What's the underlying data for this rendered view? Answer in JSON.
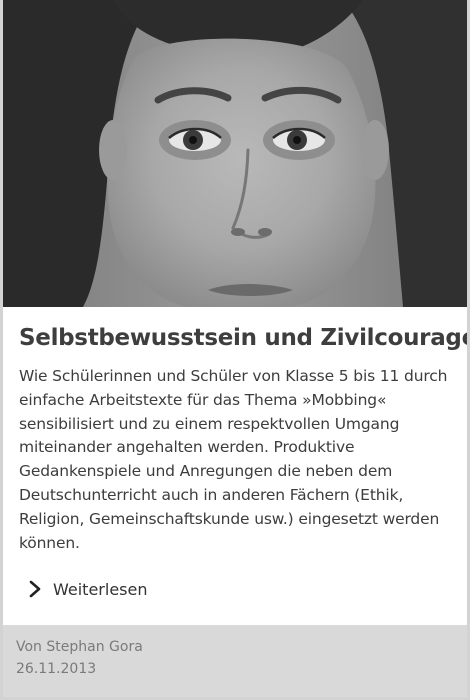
{
  "image": {
    "description_icon": "portrait-photo"
  },
  "article": {
    "title": "Selbstbewusstsein und Zivilcourage",
    "teaser": "Wie Schülerinnen und Schüler von Klasse 5 bis 11 durch einfache Arbeitstexte für das Thema »Mobbing« sensibilisiert und zu einem respektvollen Umgang miteinander angehalten werden. Produktive Gedankenspiele und Anregungen die neben dem Deutschunterricht auch in anderen Fächern (Ethik, Religion, Gemeinschaftskunde usw.) eingesetzt werden können.",
    "read_more_label": "Weiterlesen",
    "read_more_icon": "chevron-right-icon"
  },
  "footer": {
    "author": "Von Stephan Gora",
    "date": "26.11.2013"
  },
  "colors": {
    "footer_bg": "#d9d9d9",
    "title_color": "#3e3e3e",
    "border": "#d3d3d3"
  }
}
